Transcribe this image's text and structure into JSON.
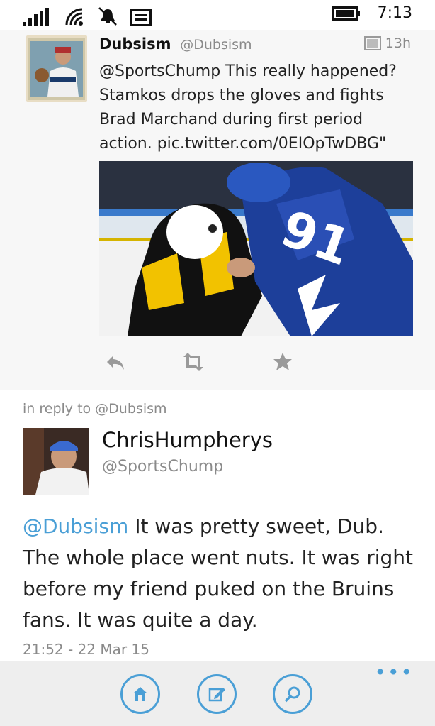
{
  "status_bar": {
    "time": "7:13"
  },
  "quoted_tweet": {
    "name": "Dubsism",
    "handle": "@Dubsism",
    "time": "13h",
    "text": "@SportsChump This really happened? Stamkos drops the gloves and fights Brad Marchand during first period action. pic.twitter.com/0EIOpTwDBG\"",
    "image_alt": "hockey fight photo",
    "actions": [
      "reply-icon",
      "retweet-icon",
      "favorite-icon"
    ]
  },
  "reply": {
    "in_reply_to": "in reply to @Dubsism",
    "name": "ChrisHumpherys",
    "handle": "@SportsChump",
    "mention": "@Dubsism",
    "text": " It was pretty sweet, Dub. The whole place went nuts.  It was right before my friend puked on the Bruins fans.  It was quite a day.",
    "date": "21:52 - 22 Mar 15"
  },
  "app_bar": {
    "buttons": [
      "home-icon",
      "compose-icon",
      "search-icon"
    ],
    "more": "•••"
  },
  "colors": {
    "accent": "#4a9fd6",
    "quoted_bg": "#f7f7f7",
    "appbar_bg": "#eeeeee"
  }
}
